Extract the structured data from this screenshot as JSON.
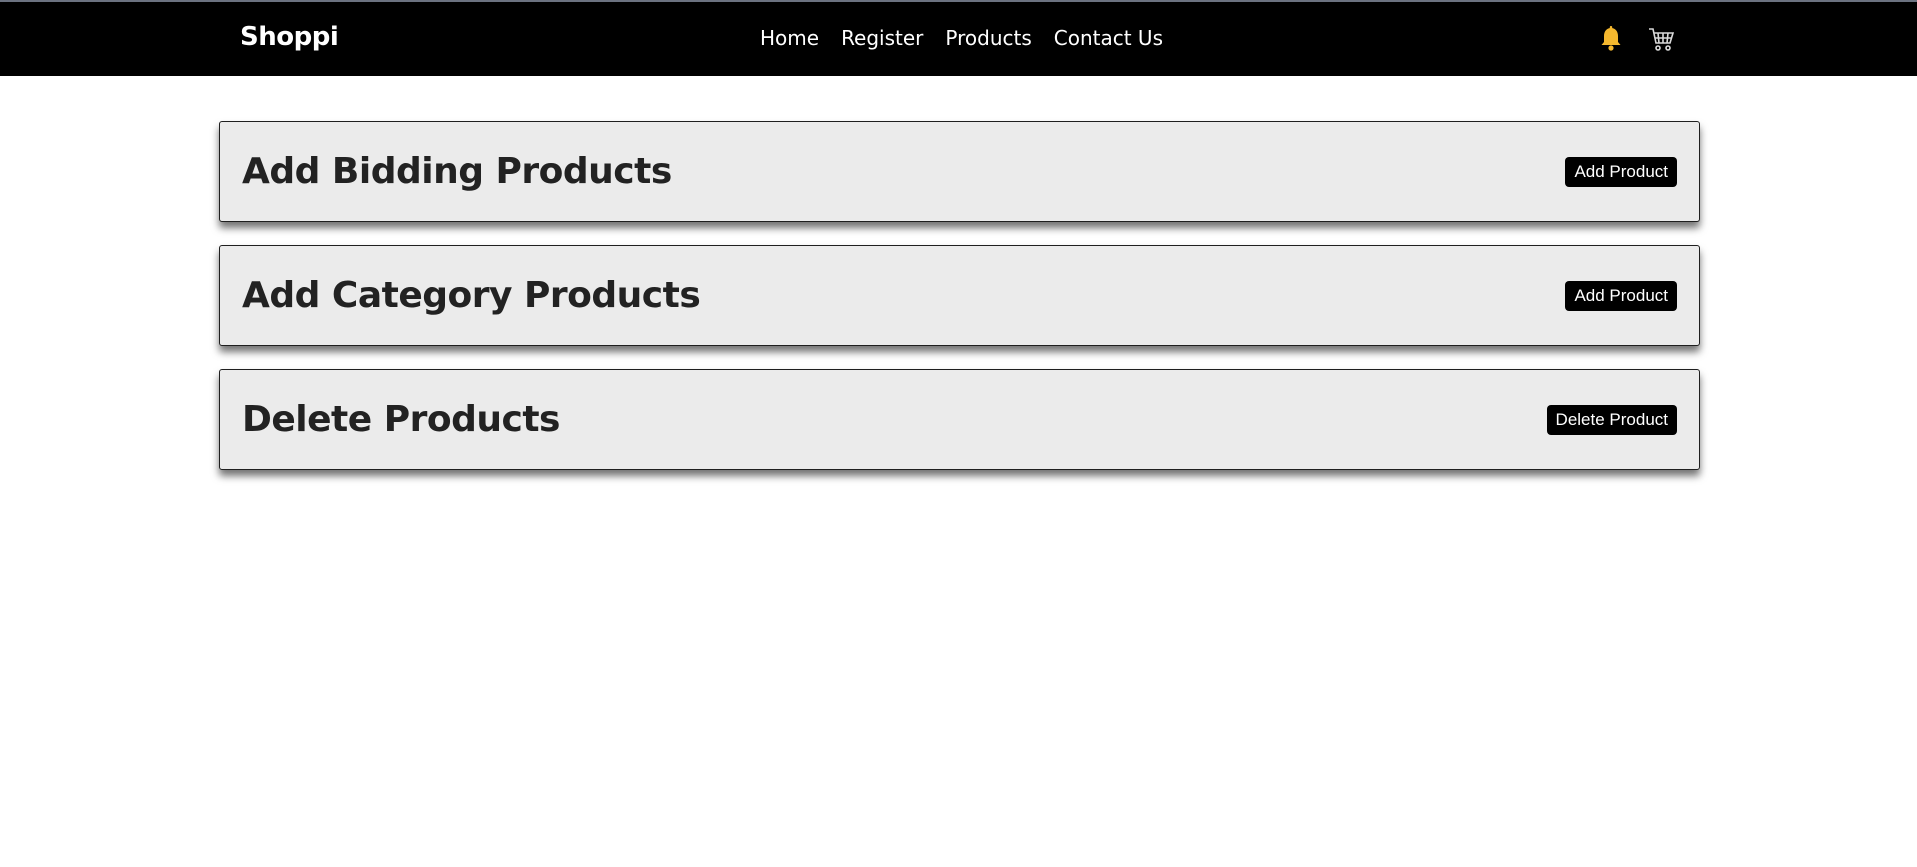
{
  "header": {
    "brand": "Shoppi",
    "nav": [
      "Home",
      "Register",
      "Products",
      "Contact Us"
    ],
    "icons": [
      "bell-icon",
      "cart-icon"
    ],
    "bell_color": "#f5b82e"
  },
  "cards": [
    {
      "title": "Add Bidding Products",
      "button": "Add Product"
    },
    {
      "title": "Add Category Products",
      "button": "Add Product"
    },
    {
      "title": "Delete Products",
      "button": "Delete Product"
    }
  ]
}
